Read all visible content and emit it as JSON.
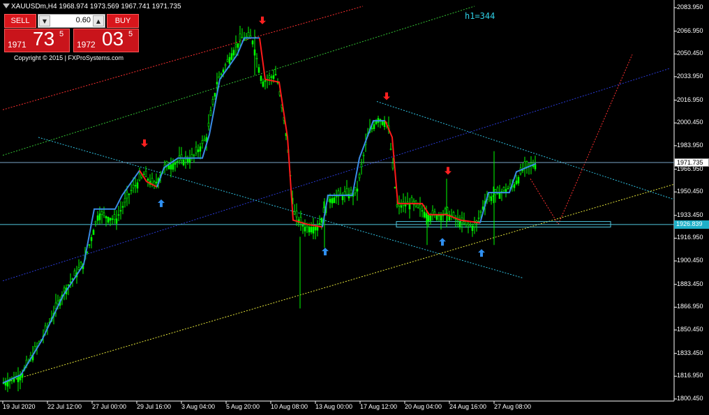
{
  "window": {
    "title": "XAUUSDm,H4  1968.974 1973.569 1967.741 1971.735",
    "indicator_label": "h1=344"
  },
  "trade_panel": {
    "sell_label": "SELL",
    "buy_label": "BUY",
    "lot_value": "0.60",
    "lot_down_icon": "▼",
    "lot_up_icon": "▲",
    "sell_price": {
      "prefix": "1971",
      "big": "73",
      "sup": "5"
    },
    "buy_price": {
      "prefix": "1972",
      "big": "03",
      "sup": "5"
    },
    "copyright": "Copyright © 2015 | FXProSystems.com"
  },
  "colors": {
    "background": "#000000",
    "bull_candle": "#00ff00",
    "bear_candle": "#00ff00",
    "trend_up": "#3a8ce6",
    "trend_down": "#ff1a1a",
    "channel_red": "#ff3030",
    "channel_green": "#34c434",
    "channel_blue": "#2a3bd8",
    "channel_yellow": "#e6e63a",
    "channel_cyan": "#30c0e0",
    "hline": "#4fc8e0",
    "arrow_up": "#2f8ff0",
    "arrow_down": "#ff2020"
  },
  "axis": {
    "y_labels": [
      "2083.950",
      "2066.950",
      "2050.450",
      "2033.950",
      "2016.950",
      "2000.450",
      "1983.950",
      "1966.950",
      "1950.450",
      "1933.450",
      "1916.950",
      "1900.450",
      "1883.450",
      "1866.950",
      "1850.450",
      "1833.450",
      "1816.950",
      "1800.450"
    ],
    "x_labels": [
      "19 Jul 2020",
      "22 Jul 12:00",
      "27 Jul 00:00",
      "29 Jul 16:00",
      "3 Aug 04:00",
      "5 Aug 20:00",
      "10 Aug 08:00",
      "13 Aug 00:00",
      "17 Aug 12:00",
      "20 Aug 04:00",
      "24 Aug 16:00",
      "27 Aug 08:00"
    ],
    "current_price_tag": "1971.735",
    "level_price_tag": "1926.839"
  },
  "chart_data": {
    "type": "candlestick",
    "symbol": "XAUUSDm",
    "timeframe": "H4",
    "ohlc_last": {
      "open": 1968.974,
      "high": 1973.569,
      "low": 1967.741,
      "close": 1971.735
    },
    "ylim": [
      1800.45,
      2083.95
    ],
    "horizontal_lines": [
      1971.735,
      1926.839
    ],
    "trend_segments": [
      {
        "direction": "up",
        "from": "19 Jul 2020",
        "to": "29 Jul 16:00"
      },
      {
        "direction": "down",
        "from": "29 Jul 16:00",
        "to": "31 Jul 00:00"
      },
      {
        "direction": "up",
        "from": "31 Jul 00:00",
        "to": "6 Aug 20:00"
      },
      {
        "direction": "down",
        "from": "6 Aug 20:00",
        "to": "13 Aug 00:00"
      },
      {
        "direction": "up",
        "from": "13 Aug 00:00",
        "to": "17 Aug 20:00"
      },
      {
        "direction": "down",
        "from": "17 Aug 20:00",
        "to": "25 Aug 00:00"
      },
      {
        "direction": "up",
        "from": "25 Aug 00:00",
        "to": "28 Aug 20:00"
      }
    ],
    "signals": [
      {
        "type": "sell",
        "price": 1986
      },
      {
        "type": "buy",
        "price": 1942
      },
      {
        "type": "sell",
        "price": 2075
      },
      {
        "type": "buy",
        "price": 1907
      },
      {
        "type": "sell",
        "price": 2020
      },
      {
        "type": "sell",
        "price": 1966
      },
      {
        "type": "buy",
        "price": 1914
      },
      {
        "type": "buy",
        "price": 1906
      }
    ]
  }
}
